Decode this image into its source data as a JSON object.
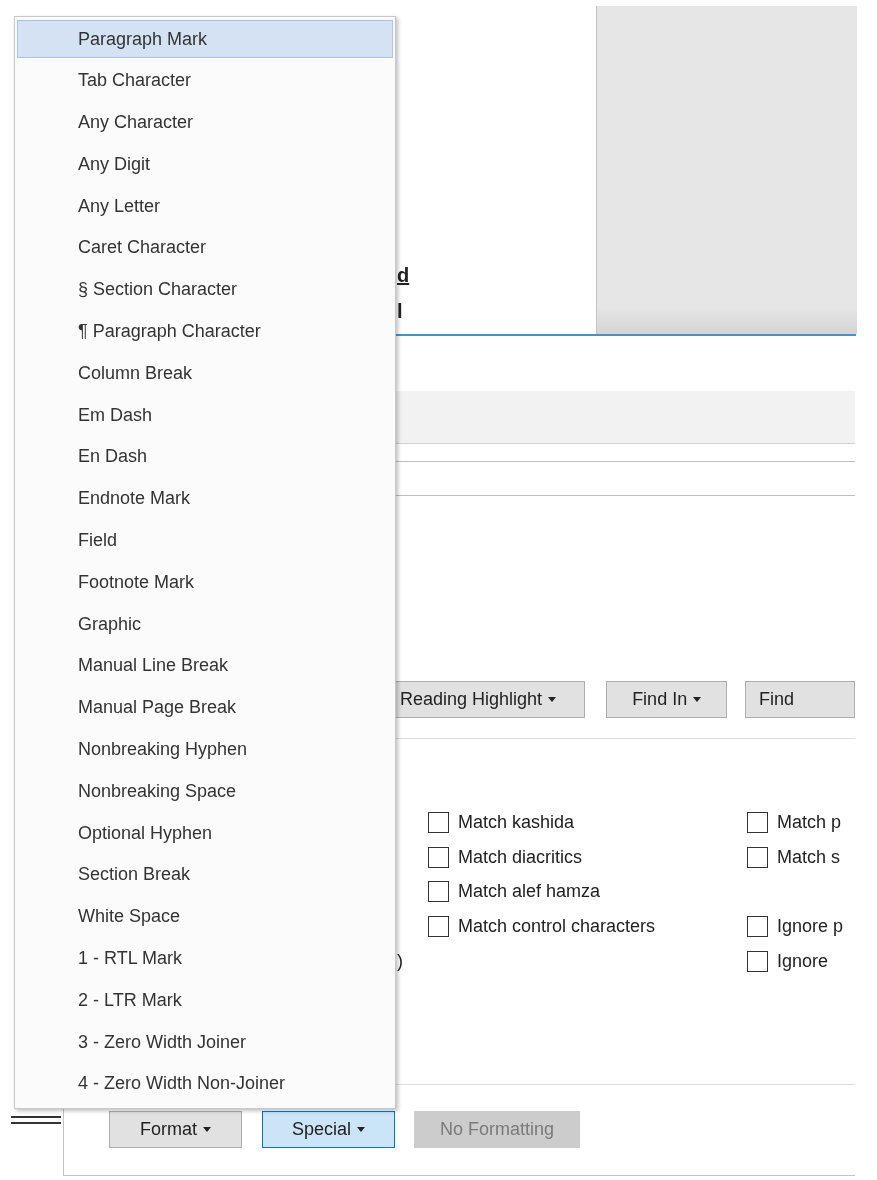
{
  "document": {
    "fragments": [
      {
        "text": "d",
        "underlined": true
      },
      {
        "text": "l",
        "underlined": false
      }
    ]
  },
  "dialog": {
    "search_buttons": [
      {
        "label": "Reading Highlight",
        "dropdown": true
      },
      {
        "label": "Find In",
        "dropdown": true
      },
      {
        "label": "Find",
        "dropdown": false
      }
    ],
    "label_fragment": ")",
    "options_left": [
      {
        "label": "Match kashida",
        "checked": false
      },
      {
        "label": "Match diacritics",
        "checked": false
      },
      {
        "label": "Match alef hamza",
        "checked": false
      },
      {
        "label": "Match control characters",
        "checked": false
      }
    ],
    "options_right": [
      {
        "items": [
          {
            "label": "Match p",
            "checked": false
          },
          {
            "label": "Match s",
            "checked": false
          }
        ]
      },
      {
        "items": [
          {
            "label": "Ignore p",
            "checked": false
          },
          {
            "label": "Ignore",
            "checked": false
          }
        ]
      }
    ],
    "bottom_buttons": [
      {
        "label": "Format",
        "dropdown": true,
        "pressed": false,
        "disabled": false
      },
      {
        "label": "Special",
        "dropdown": true,
        "pressed": true,
        "disabled": false
      },
      {
        "label": "No Formatting",
        "dropdown": false,
        "pressed": false,
        "disabled": true
      }
    ]
  },
  "special_menu": {
    "items": [
      {
        "label": "Paragraph Mark",
        "selected": true
      },
      {
        "label": "Tab Character",
        "selected": false
      },
      {
        "label": "Any Character",
        "selected": false
      },
      {
        "label": "Any Digit",
        "selected": false
      },
      {
        "label": "Any Letter",
        "selected": false
      },
      {
        "label": "Caret Character",
        "selected": false
      },
      {
        "label": "§ Section Character",
        "selected": false
      },
      {
        "label": "¶ Paragraph Character",
        "selected": false
      },
      {
        "label": "Column Break",
        "selected": false
      },
      {
        "label": "Em Dash",
        "selected": false
      },
      {
        "label": "En Dash",
        "selected": false
      },
      {
        "label": "Endnote Mark",
        "selected": false
      },
      {
        "label": "Field",
        "selected": false
      },
      {
        "label": "Footnote Mark",
        "selected": false
      },
      {
        "label": "Graphic",
        "selected": false
      },
      {
        "label": "Manual Line Break",
        "selected": false
      },
      {
        "label": "Manual Page Break",
        "selected": false
      },
      {
        "label": "Nonbreaking Hyphen",
        "selected": false
      },
      {
        "label": "Nonbreaking Space",
        "selected": false
      },
      {
        "label": "Optional Hyphen",
        "selected": false
      },
      {
        "label": "Section Break",
        "selected": false
      },
      {
        "label": "White Space",
        "selected": false
      },
      {
        "label": "1 - RTL Mark",
        "selected": false
      },
      {
        "label": "2 - LTR Mark",
        "selected": false
      },
      {
        "label": "3 - Zero Width Joiner",
        "selected": false
      },
      {
        "label": "4 - Zero Width Non-Joiner",
        "selected": false
      }
    ]
  }
}
